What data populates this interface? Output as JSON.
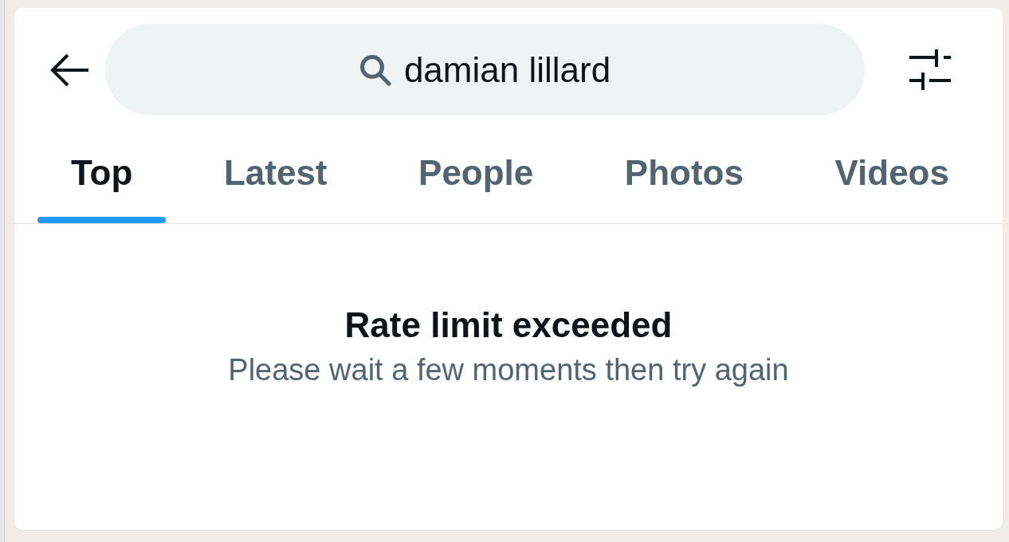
{
  "search": {
    "value": "damian lillard"
  },
  "tabs": [
    {
      "label": "Top",
      "selected": true
    },
    {
      "label": "Latest",
      "selected": false
    },
    {
      "label": "People",
      "selected": false
    },
    {
      "label": "Photos",
      "selected": false
    },
    {
      "label": "Videos",
      "selected": false
    }
  ],
  "message": {
    "title": "Rate limit exceeded",
    "detail": "Please wait a few moments then try again"
  }
}
